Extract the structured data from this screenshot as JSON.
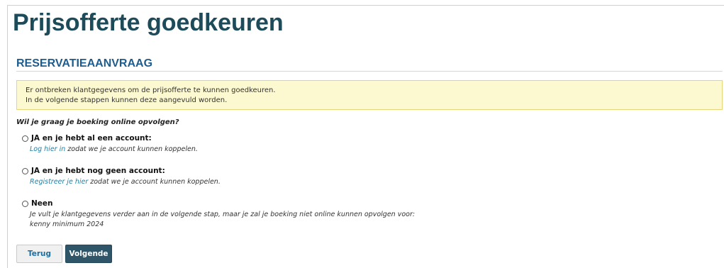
{
  "page": {
    "title": "Prijsofferte goedkeuren"
  },
  "section": {
    "title": "RESERVATIEAANVRAAG"
  },
  "notice": {
    "line1": "Er ontbreken klantgegevens om de prijsofferte te kunnen goedkeuren.",
    "line2": "In de volgende stappen kunnen deze aangevuld worden.",
    "background_color": "#fcf8d0"
  },
  "question": "Wil je graag je boeking online opvolgen?",
  "options": [
    {
      "label": "JA en je hebt al een account:",
      "link_text": "Log hier in",
      "desc_text": " zodat we je account kunnen koppelen.",
      "selected": false
    },
    {
      "label": "JA en je hebt nog geen account:",
      "link_text": "Registreer je hier",
      "desc_text": " zodat we je account kunnen koppelen.",
      "selected": false
    },
    {
      "label": "Neen",
      "desc_line1": "Je vult je klantgegevens verder aan in de volgende stap, maar je zal je boeking niet online kunnen opvolgen voor:",
      "desc_line2": "kenny minimum 2024",
      "selected": false
    }
  ],
  "buttons": {
    "back_label": "Terug",
    "next_label": "Volgende"
  },
  "colors": {
    "title": "#1d4b5a",
    "section_title": "#1d5c8f",
    "link": "#1f7fa3",
    "primary_button": "#2f5668"
  }
}
